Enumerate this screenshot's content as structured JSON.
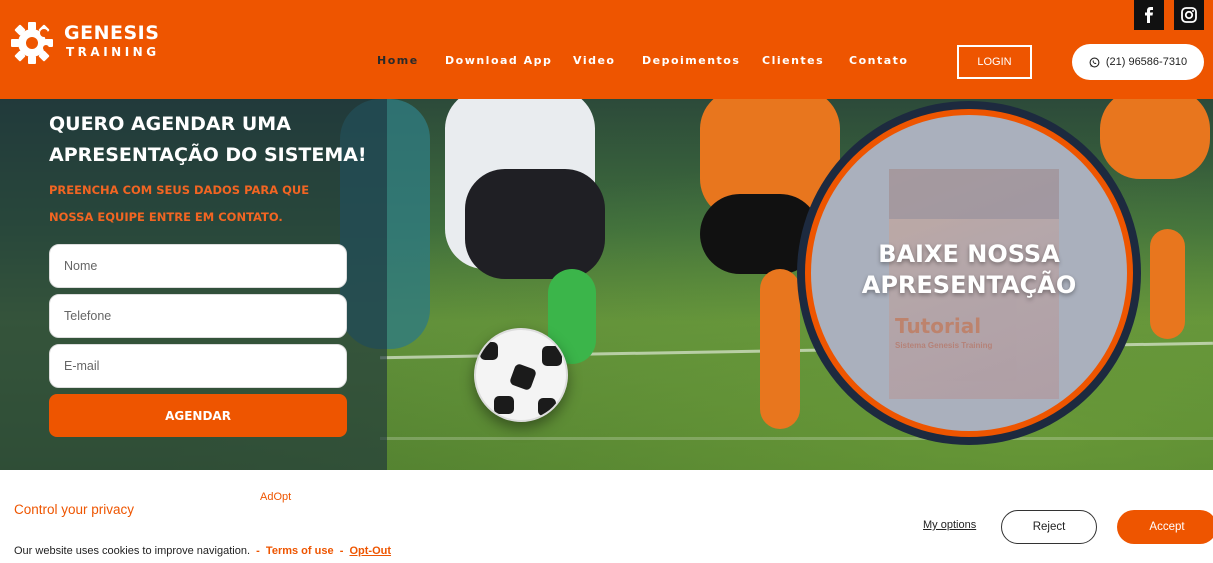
{
  "brand": {
    "name": "GENESIS",
    "tagline": "TRAINING",
    "accent": "#ee5500"
  },
  "nav": [
    {
      "label": "Home",
      "active": true
    },
    {
      "label": "Download App"
    },
    {
      "label": "Video"
    },
    {
      "label": "Depoimentos"
    },
    {
      "label": "Clientes"
    },
    {
      "label": "Contato"
    }
  ],
  "header": {
    "login_label": "LOGIN",
    "phone": "(21) 96586-7310",
    "social": [
      "facebook-icon",
      "instagram-icon"
    ]
  },
  "form": {
    "title": "QUERO AGENDAR UMA APRESENTAÇÃO DO SISTEMA!",
    "subtitle": "PREENCHA COM SEUS DADOS PARA QUE NOSSA EQUIPE ENTRE EM CONTATO.",
    "fields": [
      {
        "placeholder": "Nome"
      },
      {
        "placeholder": "Telefone"
      },
      {
        "placeholder": "E-mail"
      }
    ],
    "submit_label": "AGENDAR"
  },
  "promo": {
    "text": "BAIXE NOSSA APRESENTAÇÃO",
    "box_title": "Tutorial",
    "box_subtitle": "Sistema Genesis Training"
  },
  "cookie": {
    "title": "Control your privacy",
    "brand": "AdOpt",
    "text": "Our website uses cookies to improve navigation.",
    "terms_label": "Terms of use",
    "optout_label": "Opt-Out",
    "options_label": "My options",
    "reject_label": "Reject",
    "accept_label": "Accept"
  }
}
